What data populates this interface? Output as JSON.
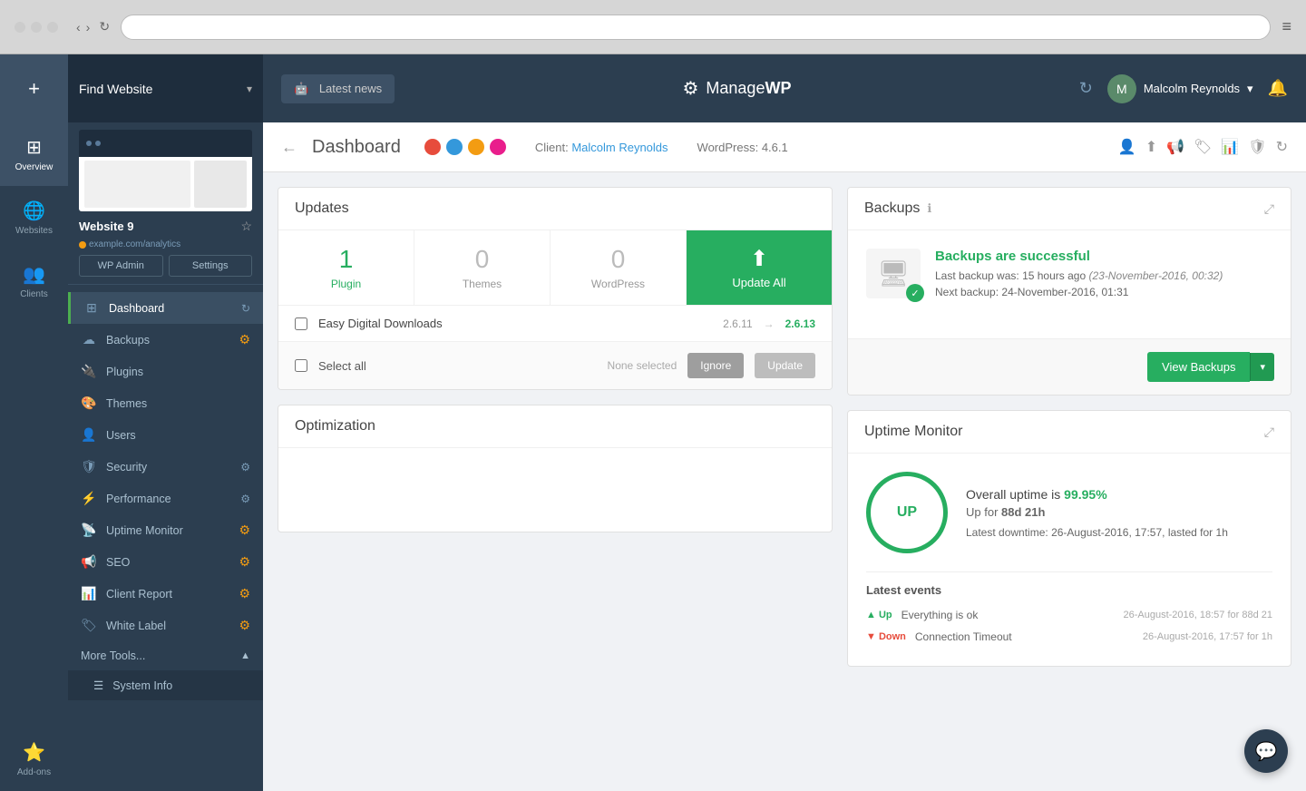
{
  "browser": {
    "traffic_lights": [
      "gray",
      "gray",
      "gray"
    ],
    "menu_icon": "≡"
  },
  "header": {
    "find_website_label": "Find Website",
    "news_label": "Latest news",
    "logo_text": "ManageWP",
    "logo_prefix": "Manage",
    "logo_suffix": "WP",
    "refresh_icon": "↻",
    "user_name": "Malcolm Reynolds",
    "user_chevron": "▾",
    "bell_icon": "🔔"
  },
  "sidebar": {
    "website_name": "Website 9",
    "website_url": "example.com/analytics",
    "wp_admin_label": "WP Admin",
    "settings_label": "Settings",
    "nav_items": [
      {
        "id": "dashboard",
        "label": "Dashboard",
        "icon": "⊞",
        "active": true,
        "badge": "refresh"
      },
      {
        "id": "backups",
        "label": "Backups",
        "icon": "☁",
        "badge": "gear_orange"
      },
      {
        "id": "plugins",
        "label": "Plugins",
        "icon": "🔌",
        "badge": ""
      },
      {
        "id": "themes",
        "label": "Themes",
        "icon": "🎨",
        "badge": ""
      },
      {
        "id": "users",
        "label": "Users",
        "icon": "👤",
        "badge": ""
      },
      {
        "id": "security",
        "label": "Security",
        "icon": "🛡",
        "badge": "gear_gray"
      },
      {
        "id": "performance",
        "label": "Performance",
        "icon": "⚡",
        "badge": "gear_gray"
      },
      {
        "id": "uptime_monitor",
        "label": "Uptime Monitor",
        "icon": "📡",
        "badge": "gear_orange"
      },
      {
        "id": "seo",
        "label": "SEO",
        "icon": "📢",
        "badge": "gear_orange"
      },
      {
        "id": "client_report",
        "label": "Client Report",
        "icon": "📊",
        "badge": "gear_orange"
      },
      {
        "id": "white_label",
        "label": "White Label",
        "icon": "🏷",
        "badge": "gear_orange"
      }
    ],
    "more_tools_label": "More Tools...",
    "system_info_label": "System Info"
  },
  "rail": {
    "items": [
      {
        "id": "overview",
        "label": "Overview",
        "icon": "⊞"
      },
      {
        "id": "websites",
        "label": "Websites",
        "icon": "🌐"
      },
      {
        "id": "clients",
        "label": "Clients",
        "icon": "👥"
      },
      {
        "id": "add-ons",
        "label": "Add-ons",
        "icon": "⭐"
      }
    ],
    "add_icon": "+"
  },
  "dashboard": {
    "back_icon": "←",
    "title": "Dashboard",
    "color_dots": [
      "#e74c3c",
      "#3498db",
      "#f39c12",
      "#e91e8c"
    ],
    "client_label": "Client:",
    "client_name": "Malcolm Reynolds",
    "wp_label": "WordPress:",
    "wp_version": "4.6.1",
    "action_icons": [
      "👤",
      "⬆",
      "📢",
      "🏷",
      "📊",
      "🛡",
      "↻"
    ]
  },
  "updates": {
    "card_title": "Updates",
    "plugin_count": "1",
    "themes_count": "0",
    "wordpress_count": "0",
    "plugin_label": "Plugin",
    "themes_label": "Themes",
    "wordpress_label": "WordPress",
    "update_all_label": "Update All",
    "plugin_item": {
      "name": "Easy Digital Downloads",
      "from": "2.6.11",
      "to": "2.6.13"
    },
    "select_all_label": "Select all",
    "none_selected_label": "None selected",
    "ignore_label": "Ignore",
    "update_label": "Update"
  },
  "optimization": {
    "card_title": "Optimization"
  },
  "backups": {
    "card_title": "Backups",
    "info_icon": "ℹ",
    "success_title": "Backups are successful",
    "last_backup_label": "Last backup was:",
    "last_backup_time": "15 hours ago",
    "last_backup_date": "(23-November-2016, 00:32)",
    "next_backup_label": "Next backup:",
    "next_backup_time": "24-November-2016, 01:31",
    "view_backups_label": "View Backups",
    "expand_icon": "⤢"
  },
  "uptime": {
    "card_title": "Uptime Monitor",
    "expand_icon": "⤢",
    "status": "UP",
    "overall_label": "Overall uptime is",
    "uptime_percent": "99.95%",
    "up_for_label": "Up for",
    "up_duration": "88d 21h",
    "latest_downtime_label": "Latest downtime:",
    "latest_downtime_time": "26-August-2016, 17:57, lasted for 1h",
    "latest_events_title": "Latest events",
    "events": [
      {
        "type": "Up",
        "label": "Everything is ok",
        "time": "26-August-2016, 18:57 for 88d 21"
      },
      {
        "type": "Down",
        "label": "Connection Timeout",
        "time": "26-August-2016, 17:57 for 1h"
      }
    ]
  },
  "chat": {
    "icon": "💬"
  }
}
